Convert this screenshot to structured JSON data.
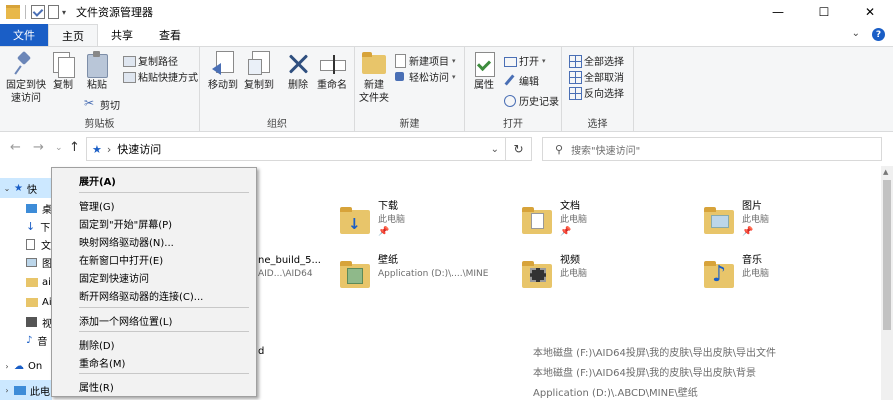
{
  "window": {
    "title": "文件资源管理器",
    "controls": {
      "minimize": "—",
      "maximize": "☐",
      "close": "✕"
    }
  },
  "ribbon_tabs": {
    "file": "文件",
    "items": [
      "主页",
      "共享",
      "查看"
    ],
    "active": "主页",
    "expand": "⌄",
    "help": "?"
  },
  "ribbon": {
    "clipboard": {
      "label": "剪贴板",
      "pin_line1": "固定到快",
      "pin_line2": "速访问",
      "copy": "复制",
      "paste": "粘贴",
      "copy_path": "复制路径",
      "paste_shortcut": "粘贴快捷方式",
      "cut": "剪切"
    },
    "organize": {
      "label": "组织",
      "move_to": "移动到",
      "copy_to": "复制到",
      "delete": "删除",
      "rename": "重命名"
    },
    "new": {
      "label": "新建",
      "new_folder_line1": "新建",
      "new_folder_line2": "文件夹",
      "new_item": "新建项目",
      "easy_access": "轻松访问"
    },
    "open": {
      "label": "打开",
      "properties": "属性",
      "open": "打开",
      "edit": "编辑",
      "history": "历史记录"
    },
    "select": {
      "label": "选择",
      "select_all": "全部选择",
      "select_none": "全部取消",
      "invert": "反向选择"
    }
  },
  "address": {
    "back": "←",
    "forward": "→",
    "recent": "⌄",
    "up": "↑",
    "separator": "›",
    "location": "快速访问",
    "dropdown": "⌄",
    "refresh": "↻",
    "search_placeholder": "搜索\"快速访问\""
  },
  "nav_pane": {
    "items": [
      {
        "label": "快",
        "icon": "star-icon"
      },
      {
        "label": "桌",
        "icon": "desktop-icon"
      },
      {
        "label": "下",
        "icon": "download-icon"
      },
      {
        "label": "文",
        "icon": "document-icon"
      },
      {
        "label": "图",
        "icon": "picture-icon"
      },
      {
        "label": "ai",
        "icon": "folder-icon"
      },
      {
        "label": "Ai",
        "icon": "folder-icon"
      },
      {
        "label": "视",
        "icon": "video-icon"
      },
      {
        "label": "音",
        "icon": "music-icon"
      },
      {
        "label": "On",
        "icon": "onedrive-icon"
      },
      {
        "label": "此电",
        "icon": "computer-icon"
      }
    ]
  },
  "folders": [
    {
      "name": "下载",
      "location": "此电脑",
      "pinned": "📌"
    },
    {
      "name": "文档",
      "location": "此电脑",
      "pinned": "📌"
    },
    {
      "name": "图片",
      "location": "此电脑",
      "pinned": "📌"
    },
    {
      "name": "ne_build_5...",
      "location": "AID...\\AID64"
    },
    {
      "name": "壁纸",
      "location": "Application (D:)\\....\\MINE"
    },
    {
      "name": "视频",
      "location": "此电脑"
    },
    {
      "name": "音乐",
      "location": "此电脑"
    }
  ],
  "recent_files": {
    "partial": "d",
    "items": [
      "本地磁盘 (F:)\\AID64投屏\\我的皮肤\\导出皮肤\\导出文件",
      "本地磁盘 (F:)\\AID64投屏\\我的皮肤\\导出皮肤\\背景",
      "Application (D:)\\.ABCD\\MINE\\壁纸"
    ]
  },
  "context_menu": {
    "items": [
      "展开(A)",
      "管理(G)",
      "固定到\"开始\"屏幕(P)",
      "映射网络驱动器(N)...",
      "在新窗口中打开(E)",
      "固定到快速访问",
      "断开网络驱动器的连接(C)...",
      "添加一个网络位置(L)",
      "删除(D)",
      "重命名(M)",
      "属性(R)"
    ]
  },
  "colors": {
    "accent": "#1a5ec6",
    "ribbon_bg": "#f5f6f7",
    "selection": "#cce8ff",
    "menu_bg": "#f2f2f2"
  }
}
